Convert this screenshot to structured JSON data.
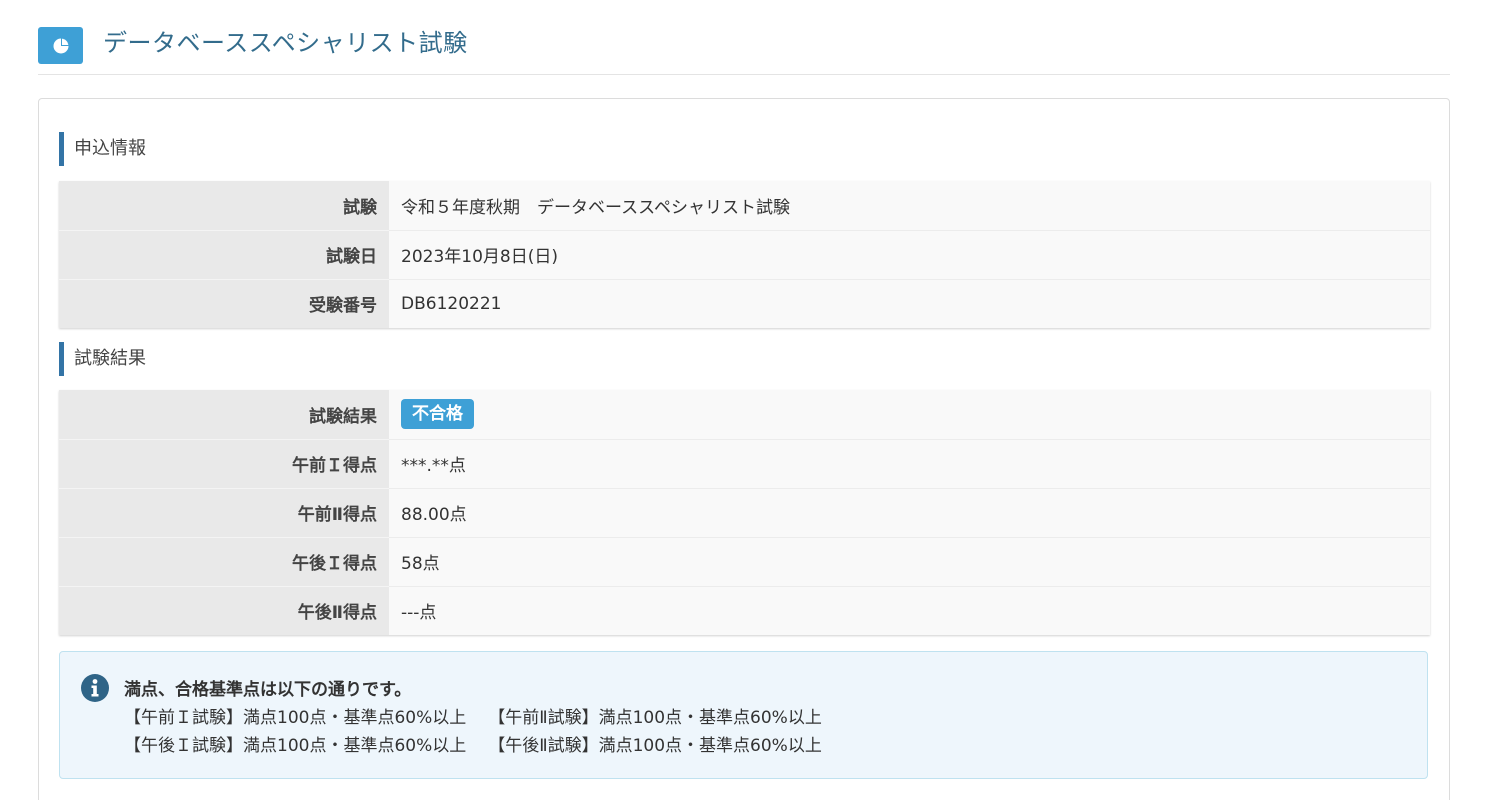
{
  "header": {
    "title": "データベーススペシャリスト試験",
    "icon": "pie-chart-icon"
  },
  "application_info": {
    "heading": "申込情報",
    "rows": [
      {
        "label": "試験",
        "value": "令和５年度秋期　データベーススペシャリスト試験"
      },
      {
        "label": "試験日",
        "value": "2023年10月8日(日)"
      },
      {
        "label": "受験番号",
        "value": "DB6120221"
      }
    ]
  },
  "exam_result": {
    "heading": "試験結果",
    "result_label": "試験結果",
    "result_badge": "不合格",
    "rows": [
      {
        "label": "午前Ｉ得点",
        "value": "***.**点"
      },
      {
        "label": "午前Ⅱ得点",
        "value": "88.00点"
      },
      {
        "label": "午後Ｉ得点",
        "value": "58点"
      },
      {
        "label": "午後Ⅱ得点",
        "value": "---点"
      }
    ]
  },
  "notice": {
    "icon": "info-icon",
    "title": "満点、合格基準点は以下の通りです。",
    "line1_a": "【午前Ｉ試験】満点100点・基準点60%以上",
    "line1_b": "【午前Ⅱ試験】満点100点・基準点60%以上",
    "line2_a": "【午後Ｉ試験】満点100点・基準点60%以上",
    "line2_b": "【午後Ⅱ試験】満点100点・基準点60%以上"
  },
  "colors": {
    "accent": "#3ea0d6",
    "heading_bar": "#3374a6",
    "title_text": "#336c8c",
    "alert_bg": "#eef6fc"
  }
}
